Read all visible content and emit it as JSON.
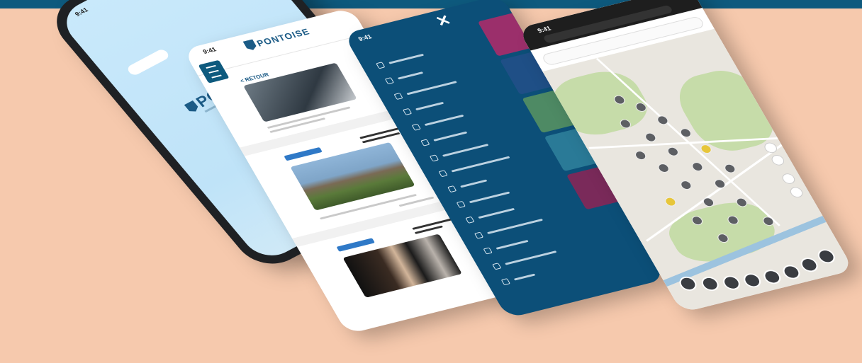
{
  "app": {
    "name": "PONTOISE",
    "status_time": "9:41"
  },
  "splash": {
    "logo_text": "PONTOISE"
  },
  "news": {
    "logo_text": "PONTOISE",
    "back_label": "< RETOUR"
  },
  "menu": {
    "close_label": "✕"
  },
  "colors": {
    "brand": "#0e5a7e",
    "background": "#f6c9ad",
    "badge": "#2f79c7",
    "menu_bg": "#0c4f78"
  },
  "icons": [
    "menu-icon",
    "close-icon",
    "map-pin-icon",
    "home-icon",
    "plus-icon"
  ]
}
